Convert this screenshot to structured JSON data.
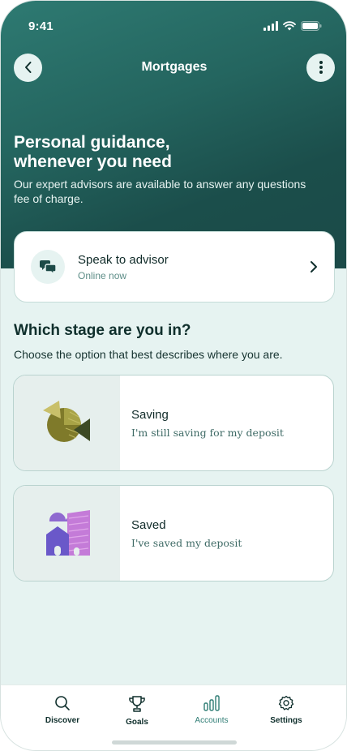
{
  "status_bar": {
    "time": "9:41",
    "icons": [
      "signal-icon",
      "wifi-icon",
      "battery-icon"
    ]
  },
  "header": {
    "title": "Mortgages",
    "back_icon": "chevron-left-icon",
    "more_icon": "more-vertical-icon"
  },
  "hero": {
    "title_line1": "Personal guidance,",
    "title_line2": "whenever you need",
    "description": "Our expert advisors are available to answer any questions fee of charge."
  },
  "advisor": {
    "title": "Speak to advisor",
    "status": "Online now",
    "icon": "chat-bubbles-icon"
  },
  "stages": {
    "heading": "Which stage are you in?",
    "subheading": "Choose the option that best describes where you are.",
    "options": [
      {
        "title": "Saving",
        "description": "I'm still saving for my deposit",
        "icon": "saving-illustration"
      },
      {
        "title": "Saved",
        "description": "I've saved my deposit",
        "icon": "houses-illustration"
      }
    ]
  },
  "tabs": [
    {
      "label": "Discover",
      "icon": "search-icon",
      "active": false
    },
    {
      "label": "Goals",
      "icon": "trophy-icon",
      "active": false
    },
    {
      "label": "Accounts",
      "icon": "bar-chart-icon",
      "active": true
    },
    {
      "label": "Settings",
      "icon": "gear-icon",
      "active": false
    }
  ],
  "colors": {
    "hero_start": "#2e7a72",
    "hero_end": "#1b4a48",
    "background": "#e6f3f1",
    "accent": "#2f7d75"
  }
}
